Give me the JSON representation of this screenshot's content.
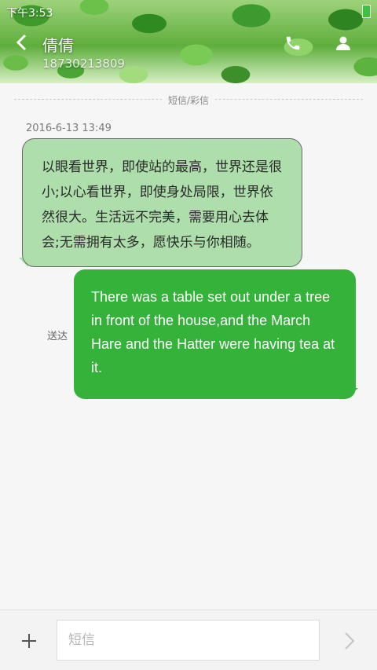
{
  "status_bar": {
    "time": "下午3:53"
  },
  "header": {
    "contact_name": "倩倩",
    "contact_number": "18730213809"
  },
  "thread": {
    "channel_label": "短信/彩信",
    "timestamp": "2016-6-13 13:49",
    "incoming_message": "以眼看世界，即使站的最高，世界还是很小;以心看世界，即使身处局限，世界依然很大。生活远不完美，需要用心去体会;无需拥有太多，愿快乐与你相随。",
    "outgoing_message": "There was a table set out under a tree in front of the house,and the March Hare and the Hatter were having tea at it.",
    "delivery_status": "送达"
  },
  "composer": {
    "placeholder": "短信"
  },
  "colors": {
    "incoming_bubble": "#addeab",
    "outgoing_bubble": "#34b23a",
    "background": "#f6f6f6"
  }
}
